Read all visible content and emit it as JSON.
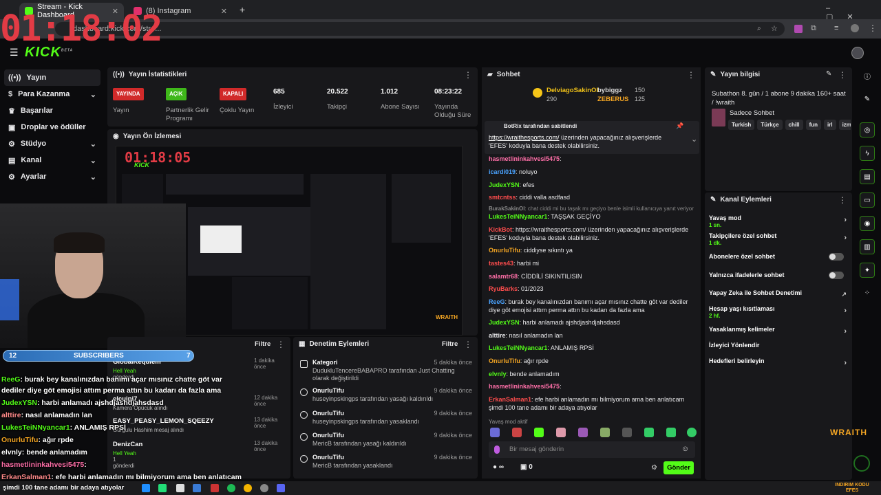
{
  "browser": {
    "tabs": [
      {
        "label": "Stream - Kick Dashboard",
        "favicon_color": "#53fc18"
      },
      {
        "label": "(8) Instagram",
        "favicon_color": "#e1306c"
      }
    ],
    "url": "dashboard.kick.com/stre...",
    "new_tab": "+"
  },
  "overlay_clock": "01:18:02",
  "kick": {
    "logo": "KICK",
    "beta": "BETA"
  },
  "sidebar": {
    "items": [
      {
        "label": "Yayın",
        "icon": "broadcast-icon"
      },
      {
        "label": "Para Kazanma",
        "icon": "dollar-icon"
      },
      {
        "label": "Başarılar",
        "icon": "trophy-icon"
      },
      {
        "label": "Droplar ve ödüller",
        "icon": "gift-icon"
      },
      {
        "label": "Stüdyo",
        "icon": "gear-icon"
      },
      {
        "label": "Kanal",
        "icon": "channel-icon"
      },
      {
        "label": "Ayarlar",
        "icon": "settings-icon"
      }
    ]
  },
  "stats": {
    "title": "Yayın İstatistikleri",
    "items": [
      {
        "badge": "YAYINDA",
        "label": "Yayın"
      },
      {
        "badge": "AÇIK",
        "label": "Partnerlik Gelir Programı"
      },
      {
        "badge": "KAPALI",
        "label": "Çoklu Yayın"
      },
      {
        "value": "685",
        "label": "İzleyici"
      },
      {
        "value": "20.522",
        "label": "Takipçi"
      },
      {
        "value": "1.012",
        "label": "Abone Sayısı"
      },
      {
        "value": "08:23:22",
        "label": "Yayında Olduğu Süre"
      }
    ]
  },
  "preview": {
    "title": "Yayın Ön İzlemesi",
    "inner_clock": "01:18:05",
    "inner_logo": "KICK"
  },
  "subscribers": {
    "left": "12",
    "label": "SUBSCRIBERS",
    "right": "7"
  },
  "overlay_chat": [
    {
      "user": "ReeG",
      "msg": ": burak bey kanalınızdan banımı açar mısınız chatte göt var"
    },
    {
      "user": "",
      "msg": "dediler diye göt emojisi attım perma attın bu kadarı da fazla ama"
    },
    {
      "user": "JudexYSN",
      "msg": ": harbi anlamadı ajshdjashdjahsdasd"
    },
    {
      "user": "alttire",
      "msg": ": nasıl anlamadın lan"
    },
    {
      "user": "LukesTeiNNyancar1",
      "msg": ": ANLAMIŞ RPSİ"
    },
    {
      "user": "OnurluTifu",
      "msg": ": ağır rpde"
    },
    {
      "user": "elvnly",
      "msg": ": bende anlamadım"
    },
    {
      "user": "hasmetlininkahvesi5475",
      "msg": ":"
    },
    {
      "user": "ErkanSalman1",
      "msg": ": efe harbi anlamadın mı bilmiyorum ama ben anlatıcam"
    }
  ],
  "overlay_bottom": "şimdi 100 tane adamı bir adaya atıyolar",
  "activity": {
    "filter": "Filtre",
    "rows": [
      {
        "name": "GlobalKequiem",
        "line": "Hell Yeah",
        "sub": "gönderdi",
        "time": "1 dakika önce"
      },
      {
        "name": "elcuipi7",
        "line": "Kamera Öpücük alındı",
        "time": "12 dakika önce"
      },
      {
        "name": "EASY_PEASY_LEMON_SQEEZY",
        "line": "Gurgulu Hashim mesaj alındı",
        "time": "13 dakika önce"
      },
      {
        "name": "DenizCan",
        "line": "Hell Yeah",
        "sub": "1",
        "sub2": "gönderdi",
        "time": "13 dakika önce"
      }
    ]
  },
  "moderation": {
    "title": "Denetim Eylemleri",
    "filter": "Filtre",
    "rows": [
      {
        "title": "Kategori",
        "desc": "DudukluTencereBABAPRO tarafından Just Chatting olarak değiştirildi",
        "time": "5 dakika önce",
        "icon": "category-icon"
      },
      {
        "title": "OnurluTifu",
        "desc": "huseyinpskingps tarafından yasağı kaldırıldı",
        "time": "9 dakika önce",
        "icon": "undo-icon"
      },
      {
        "title": "OnurluTifu",
        "desc": "huseyinpskingps tarafından yasaklandı",
        "time": "9 dakika önce",
        "icon": "ban-icon"
      },
      {
        "title": "OnurluTifu",
        "desc": "MericB tarafından yasağı kaldırıldı",
        "time": "9 dakika önce",
        "icon": "undo-icon"
      },
      {
        "title": "OnurluTifu",
        "desc": "MericB tarafından yasaklandı",
        "time": "9 dakika önce",
        "icon": "ban-icon"
      }
    ]
  },
  "chat": {
    "title": "Sohbet",
    "leaders": [
      {
        "name": "DelviagoSakinOl",
        "count": "290"
      },
      {
        "name": "bybiggz",
        "count": "150"
      },
      {
        "name": "ZEBERUS",
        "count": "125"
      }
    ],
    "pinned_by": "BotRix tarafından sabitlendi",
    "pinned_link": "https://wraithesports.com/",
    "pinned_text": " üzerinden yapacağınız alışverişlerde 'EFES' koduyla bana destek olabilirsiniz.",
    "messages": [
      {
        "user": "hasmetlininkahvesi5475",
        "text": ":"
      },
      {
        "user": "icardi019",
        "text": ": noluyo"
      },
      {
        "user": "JudexYSN",
        "text": ": efes"
      },
      {
        "user": "smtcntss",
        "text": ": ciddi valla asdfasd"
      },
      {
        "user": "BurakSakinOl",
        "text": ": chat ciddi mi bu taşak mı geçiyo benle isimli kullanıcıya yanıt veriyor"
      },
      {
        "user": "LukesTeiNNyancar1",
        "text": ": TAŞŞAK GEÇİYO"
      },
      {
        "user": "KickBot",
        "text": ": https://wraithesports.com/ üzerinden yapacağınız alışverişlerde 'EFES' koduyla bana destek olabilirsiniz."
      },
      {
        "user": "OnurluTifu",
        "text": ": ciddiyse sıkıntı ya"
      },
      {
        "user": "tastes43",
        "text": ": harbi mi"
      },
      {
        "user": "salamtr68",
        "text": ": CİDDİLİ SIKINTILISIN"
      },
      {
        "user": "RyuBarks",
        "text": ": 01/2023"
      },
      {
        "user": "ReeG",
        "text": ": burak bey kanalınızdan banımı açar mısınız chatte göt var dediler diye göt emojisi attım perma attın bu kadarı da fazla ama"
      },
      {
        "user": "JudexYSN",
        "text": ": harbi anlamadı ajshdjashdjahsdasd"
      },
      {
        "user": "alttire",
        "text": ": nasıl anlamadın lan"
      },
      {
        "user": "LukesTeiNNyancar1",
        "text": ": ANLAMIŞ RPSİ"
      },
      {
        "user": "OnurluTifu",
        "text": ": ağır rpde"
      },
      {
        "user": "elvnly",
        "text": ": bende anlamadım"
      },
      {
        "user": "hasmetlininkahvesi5475",
        "text": ":"
      },
      {
        "user": "ErkanSalman1",
        "text": ": efe harbi anlamadın mı bilmiyorum ama ben anlatıcam şimdi 100 tane adamı bir adaya atıyolar"
      }
    ],
    "slow_mode": "Yavaş mod aktif",
    "input_placeholder": "Bir mesaj gönderin",
    "points": "∞",
    "gifts": "0",
    "send": "Gönder"
  },
  "stream_info": {
    "title": "Yayın bilgisi",
    "stream_title": "Subathon 8. gün / 1 abone 9 dakika 160+ saat / !wraith",
    "category": "Sadece Sohbet",
    "tags": [
      "Turkish",
      "Türkçe",
      "chill",
      "fun",
      "irl",
      "izm"
    ]
  },
  "channel_actions": {
    "title": "Kanal Eylemleri",
    "items": [
      {
        "label": "Yavaş mod",
        "sub": "1 sn.",
        "type": "arrow"
      },
      {
        "label": "Takipçilere özel sohbet",
        "sub": "1 dk.",
        "type": "arrow"
      },
      {
        "label": "Abonelere özel sohbet",
        "type": "toggle"
      },
      {
        "label": "Yalnızca ifadelerle sohbet",
        "type": "toggle"
      },
      {
        "label": "Yapay Zeka ile Sohbet Denetimi",
        "type": "external"
      },
      {
        "label": "Hesap yaşı kısıtlaması",
        "sub": "2 hf.",
        "type": "arrow"
      },
      {
        "label": "Yasaklanmış kelimeler",
        "type": "arrow"
      },
      {
        "label": "İzleyici Yönlendir",
        "type": "none"
      },
      {
        "label": "Hedefleri belirleyin",
        "type": "arrow"
      }
    ]
  },
  "watermark": "WRAITH",
  "corner_logo": "INDIRIM KODU EFES"
}
